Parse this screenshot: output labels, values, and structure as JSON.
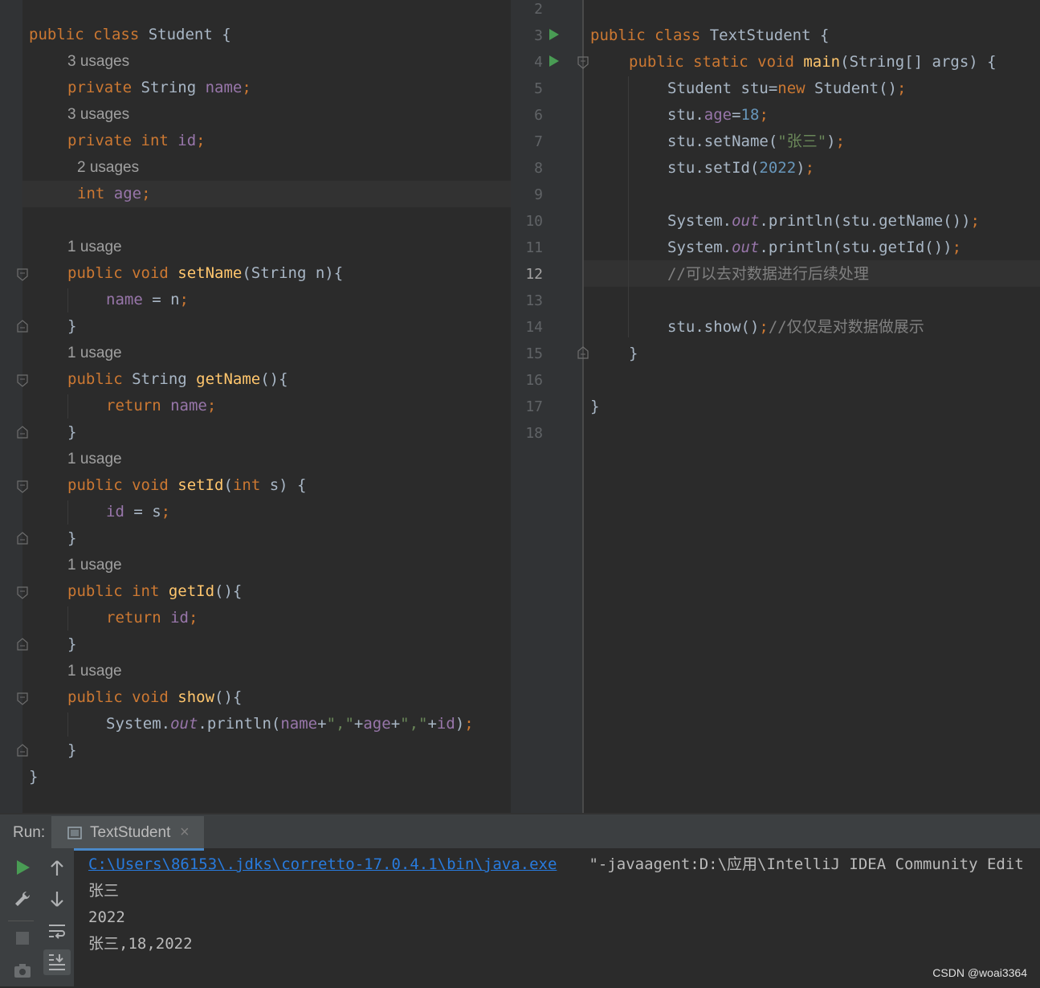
{
  "left_editor": {
    "lines": [
      {
        "type": "code",
        "tokens": [
          [
            "k",
            "public "
          ],
          [
            "k",
            "class "
          ],
          [
            "t",
            "Student {"
          ]
        ]
      },
      {
        "type": "hint",
        "text": "3 usages"
      },
      {
        "type": "code",
        "tokens": [
          [
            "k",
            "private "
          ],
          [
            "t",
            "String "
          ],
          [
            "f",
            "name"
          ],
          [
            "k",
            ";"
          ]
        ]
      },
      {
        "type": "hint",
        "text": "3 usages"
      },
      {
        "type": "code",
        "tokens": [
          [
            "k",
            "private "
          ],
          [
            "k",
            "int "
          ],
          [
            "f",
            "id"
          ],
          [
            "k",
            ";"
          ]
        ]
      },
      {
        "type": "hint",
        "text": "2 usages"
      },
      {
        "type": "code",
        "tokens": [
          [
            "k",
            "int "
          ],
          [
            "f",
            "age"
          ],
          [
            "k",
            ";"
          ]
        ]
      },
      {
        "type": "blank"
      },
      {
        "type": "hint",
        "text": "1 usage"
      },
      {
        "type": "code",
        "tokens": [
          [
            "k",
            "public "
          ],
          [
            "k",
            "void "
          ],
          [
            "m",
            "setName"
          ],
          [
            "t",
            "(String n){"
          ]
        ]
      },
      {
        "type": "code",
        "tokens": [
          [
            "f",
            "name "
          ],
          [
            "t",
            "= n"
          ],
          [
            "k",
            ";"
          ]
        ]
      },
      {
        "type": "code",
        "tokens": [
          [
            "t",
            "}"
          ]
        ]
      },
      {
        "type": "hint",
        "text": "1 usage"
      },
      {
        "type": "code",
        "tokens": [
          [
            "k",
            "public "
          ],
          [
            "t",
            "String "
          ],
          [
            "m",
            "getName"
          ],
          [
            "t",
            "(){"
          ]
        ]
      },
      {
        "type": "code",
        "tokens": [
          [
            "k",
            "return "
          ],
          [
            "f",
            "name"
          ],
          [
            "k",
            ";"
          ]
        ]
      },
      {
        "type": "code",
        "tokens": [
          [
            "t",
            "}"
          ]
        ]
      },
      {
        "type": "hint",
        "text": "1 usage"
      },
      {
        "type": "code",
        "tokens": [
          [
            "k",
            "public "
          ],
          [
            "k",
            "void "
          ],
          [
            "m",
            "setId"
          ],
          [
            "t",
            "("
          ],
          [
            "k",
            "int "
          ],
          [
            "t",
            "s) {"
          ]
        ]
      },
      {
        "type": "code",
        "tokens": [
          [
            "f",
            "id "
          ],
          [
            "t",
            "= s"
          ],
          [
            "k",
            ";"
          ]
        ]
      },
      {
        "type": "code",
        "tokens": [
          [
            "t",
            "}"
          ]
        ]
      },
      {
        "type": "hint",
        "text": "1 usage"
      },
      {
        "type": "code",
        "tokens": [
          [
            "k",
            "public "
          ],
          [
            "k",
            "int "
          ],
          [
            "m",
            "getId"
          ],
          [
            "t",
            "(){"
          ]
        ]
      },
      {
        "type": "code",
        "tokens": [
          [
            "k",
            "return "
          ],
          [
            "f",
            "id"
          ],
          [
            "k",
            ";"
          ]
        ]
      },
      {
        "type": "code",
        "tokens": [
          [
            "t",
            "}"
          ]
        ]
      },
      {
        "type": "hint",
        "text": "1 usage"
      },
      {
        "type": "code",
        "tokens": [
          [
            "k",
            "public "
          ],
          [
            "k",
            "void "
          ],
          [
            "m",
            "show"
          ],
          [
            "t",
            "(){"
          ]
        ]
      },
      {
        "type": "code",
        "tokens": [
          [
            "t",
            "System."
          ],
          [
            "st",
            "out"
          ],
          [
            "t",
            ".println("
          ],
          [
            "f",
            "name"
          ],
          [
            "t",
            "+"
          ],
          [
            "s",
            "\",\""
          ],
          [
            "t",
            "+"
          ],
          [
            "f",
            "age"
          ],
          [
            "t",
            "+"
          ],
          [
            "s",
            "\",\""
          ],
          [
            "t",
            "+"
          ],
          [
            "f",
            "id"
          ],
          [
            "t",
            ")"
          ],
          [
            "k",
            ";"
          ]
        ]
      },
      {
        "type": "code",
        "tokens": [
          [
            "t",
            "}"
          ]
        ]
      },
      {
        "type": "code",
        "tokens": [
          [
            "t",
            "}"
          ]
        ]
      }
    ]
  },
  "right_editor": {
    "line_numbers": [
      "2",
      "3",
      "4",
      "5",
      "6",
      "7",
      "8",
      "9",
      "10",
      "11",
      "12",
      "13",
      "14",
      "15",
      "16",
      "17",
      "18"
    ],
    "current_line": "12",
    "lines": [
      [],
      [
        [
          "k",
          "public "
        ],
        [
          "k",
          "class "
        ],
        [
          "t",
          "TextStudent {"
        ]
      ],
      [
        [
          "k",
          "public "
        ],
        [
          "k",
          "static "
        ],
        [
          "k",
          "void "
        ],
        [
          "m",
          "main"
        ],
        [
          "t",
          "(String[] args) {"
        ]
      ],
      [
        [
          "t",
          "Student stu="
        ],
        [
          "k",
          "new "
        ],
        [
          "t",
          "Student()"
        ],
        [
          "k",
          ";"
        ]
      ],
      [
        [
          "t",
          "stu."
        ],
        [
          "f",
          "age"
        ],
        [
          "t",
          "="
        ],
        [
          "n",
          "18"
        ],
        [
          "k",
          ";"
        ]
      ],
      [
        [
          "t",
          "stu.setName("
        ],
        [
          "s",
          "\"张三\""
        ],
        [
          "t",
          ")"
        ],
        [
          "k",
          ";"
        ]
      ],
      [
        [
          "t",
          "stu.setId("
        ],
        [
          "n",
          "2022"
        ],
        [
          "t",
          ")"
        ],
        [
          "k",
          ";"
        ]
      ],
      [],
      [
        [
          "t",
          "System."
        ],
        [
          "st",
          "out"
        ],
        [
          "t",
          ".println(stu.getName())"
        ],
        [
          "k",
          ";"
        ]
      ],
      [
        [
          "t",
          "System."
        ],
        [
          "st",
          "out"
        ],
        [
          "t",
          ".println(stu.getId())"
        ],
        [
          "k",
          ";"
        ]
      ],
      [
        [
          "c",
          "//可以去对数据进行后续处理"
        ]
      ],
      [],
      [
        [
          "t",
          "stu.show()"
        ],
        [
          "k",
          ";"
        ],
        [
          "c",
          "//仅仅是对数据做展示"
        ]
      ],
      [
        [
          "t",
          "}"
        ]
      ],
      [],
      [
        [
          "t",
          "}"
        ]
      ],
      []
    ]
  },
  "run_panel": {
    "label": "Run:",
    "tab_title": "TextStudent",
    "tab_close": "×",
    "output": {
      "command_path": "C:\\Users\\86153\\.jdks\\corretto-17.0.4.1\\bin\\java.exe",
      "command_args": " \"-javaagent:D:\\应用\\IntelliJ IDEA Community Edit",
      "lines": [
        "张三",
        "2022",
        "张三,18,2022"
      ]
    }
  },
  "watermark": "CSDN @woai3364",
  "icons": {
    "run": "run-icon",
    "wrench": "wrench-icon",
    "stop": "stop-icon",
    "camera": "camera-icon",
    "up": "arrow-up-icon",
    "down": "arrow-down-icon",
    "wrap": "soft-wrap-icon",
    "scroll": "scroll-to-end-icon"
  },
  "colors": {
    "keyword": "#cc7832",
    "field": "#9876aa",
    "method": "#ffc66d",
    "text": "#a9b7c6",
    "string": "#6a8759",
    "number": "#6897bb",
    "comment": "#808080",
    "run_green": "#499c54",
    "link": "#287bde"
  }
}
